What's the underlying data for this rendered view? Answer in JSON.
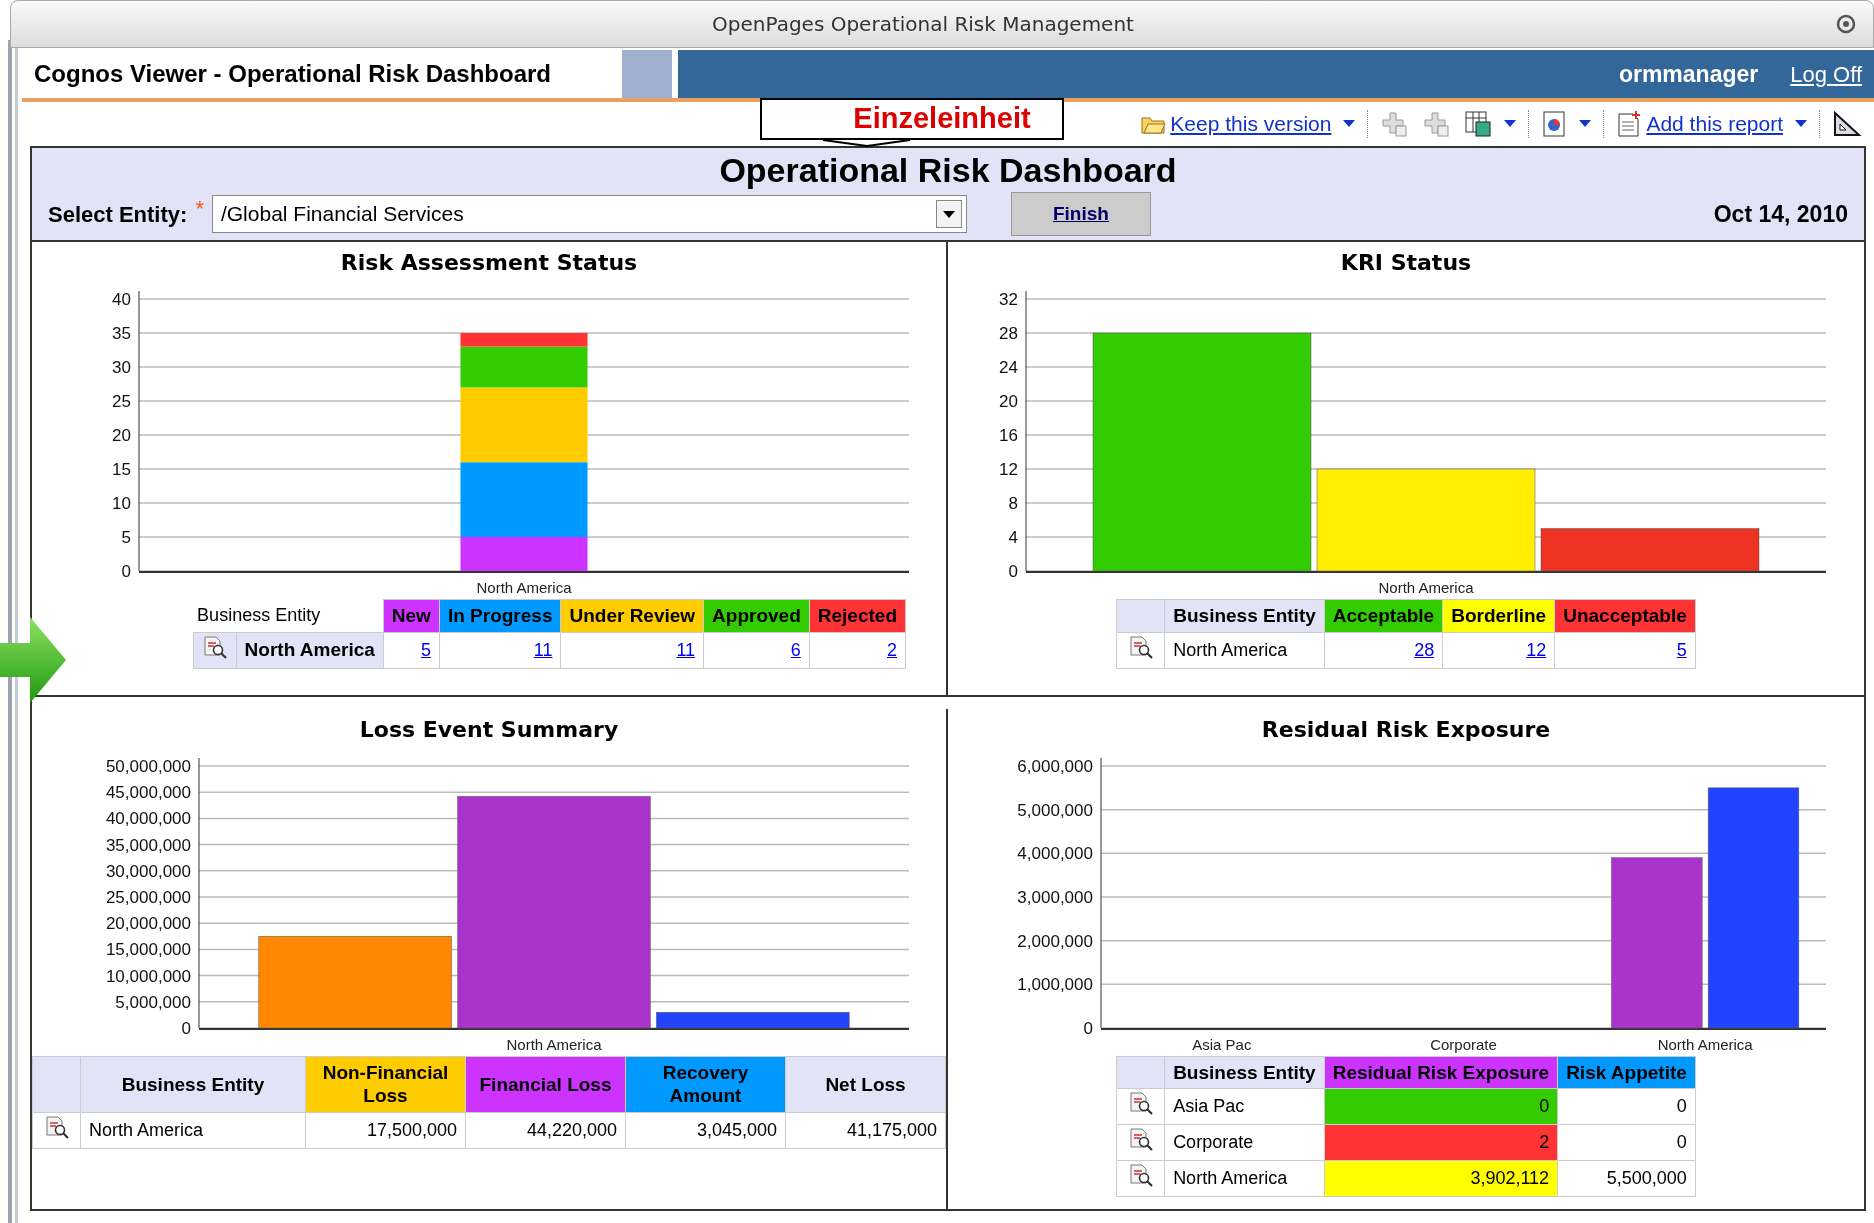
{
  "window": {
    "title": "OpenPages Operational Risk Management"
  },
  "header": {
    "title": "Cognos Viewer - Operational Risk Dashboard",
    "user": "ormmanager",
    "logoff": "Log Off"
  },
  "callout": {
    "text": "Einzeleinheit"
  },
  "toolbar": {
    "keep": "Keep this version",
    "add": "Add this report"
  },
  "dashboard": {
    "title": "Operational Risk Dashboard",
    "entity_label": "Select Entity:",
    "required_mark": "*",
    "entity_value": "/Global Financial Services",
    "finish": "Finish",
    "date": "Oct 14, 2010"
  },
  "panels": [
    {
      "title": "Risk Assessment Status",
      "chart_data": {
        "type": "bar",
        "stacked": true,
        "grid": true,
        "categories": [
          "North America"
        ],
        "series": [
          {
            "color": "#cc33ff",
            "values": [
              5
            ]
          },
          {
            "color": "#0099ff",
            "values": [
              11
            ]
          },
          {
            "color": "#ffcc00",
            "values": [
              11
            ]
          },
          {
            "color": "#33cc00",
            "values": [
              6
            ]
          },
          {
            "color": "#ff3333",
            "values": [
              2
            ]
          }
        ],
        "ylim": [
          0,
          40
        ],
        "yticks": [
          0,
          5,
          10,
          15,
          20,
          25,
          30,
          35,
          40
        ]
      },
      "table": {
        "entity_emphasis": true,
        "values_are_links": true,
        "entity_header": "Business Entity",
        "columns": [
          {
            "label": "New",
            "color": "#cc33ff"
          },
          {
            "label": "In Progress",
            "color": "#0099ff"
          },
          {
            "label": "Under Review",
            "color": "#ffcc00"
          },
          {
            "label": "Approved",
            "color": "#33cc00"
          },
          {
            "label": "Rejected",
            "color": "#ff3333"
          }
        ],
        "rows": [
          {
            "entity": "North America",
            "cells": [
              {
                "text": "5"
              },
              {
                "text": "11"
              },
              {
                "text": "11"
              },
              {
                "text": "6"
              },
              {
                "text": "2"
              }
            ]
          }
        ]
      }
    },
    {
      "title": "KRI Status",
      "chart_data": {
        "type": "bar",
        "grid": true,
        "categories": [
          "North America"
        ],
        "series": [
          {
            "color": "#33cc00",
            "values": [
              28
            ]
          },
          {
            "color": "#ffee00",
            "values": [
              12
            ]
          },
          {
            "color": "#ee3322",
            "values": [
              5
            ]
          }
        ],
        "ylim": [
          0,
          32
        ],
        "yticks": [
          0,
          4,
          8,
          12,
          16,
          20,
          24,
          28,
          32
        ]
      },
      "table": {
        "entity_emphasis": false,
        "values_are_links": true,
        "entity_header": "Business Entity",
        "columns": [
          {
            "label": "Acceptable",
            "color": "#33cc00"
          },
          {
            "label": "Borderline",
            "color": "#ffff00"
          },
          {
            "label": "Unacceptable",
            "color": "#ff3333"
          }
        ],
        "rows": [
          {
            "entity": "North America",
            "cells": [
              {
                "text": "28"
              },
              {
                "text": "12"
              },
              {
                "text": "5"
              }
            ]
          }
        ]
      }
    },
    {
      "title": "Loss Event Summary",
      "chart_data": {
        "type": "bar",
        "grid": true,
        "categories": [
          "North America"
        ],
        "series": [
          {
            "color": "#ff8800",
            "values": [
              17500000
            ]
          },
          {
            "color": "#aa33cc",
            "values": [
              44200000
            ]
          },
          {
            "color": "#2244ff",
            "values": [
              3000000
            ]
          }
        ],
        "ylim": [
          0,
          50000000
        ],
        "yticks": [
          {
            "value": 0,
            "label": "0"
          },
          {
            "value": 5000000,
            "label": "5,000,000"
          },
          {
            "value": 10000000,
            "label": "10,000,000"
          },
          {
            "value": 15000000,
            "label": "15,000,000"
          },
          {
            "value": 20000000,
            "label": "20,000,000"
          },
          {
            "value": 25000000,
            "label": "25,000,000"
          },
          {
            "value": 30000000,
            "label": "30,000,000"
          },
          {
            "value": 35000000,
            "label": "35,000,000"
          },
          {
            "value": 40000000,
            "label": "40,000,000"
          },
          {
            "value": 45000000,
            "label": "45,000,000"
          },
          {
            "value": 50000000,
            "label": "50,000,000"
          }
        ]
      },
      "table": {
        "entity_emphasis": false,
        "values_are_links": false,
        "entity_header": "Business Entity",
        "columns": [
          {
            "label": "Non-Financial Loss",
            "color": "#ffcc00"
          },
          {
            "label": "Financial Loss",
            "color": "#cc33ff"
          },
          {
            "label": "Recovery Amount",
            "color": "#0099ff"
          },
          {
            "label": "Net Loss"
          }
        ],
        "rows": [
          {
            "entity": "North America",
            "cells": [
              {
                "text": "17,500,000"
              },
              {
                "text": "44,220,000"
              },
              {
                "text": "3,045,000"
              },
              {
                "text": "41,175,000"
              }
            ]
          }
        ]
      }
    },
    {
      "title": "Residual Risk Exposure",
      "chart_data": {
        "type": "bar",
        "grid": true,
        "categories": [
          "Asia Pac",
          "Corporate",
          "North America"
        ],
        "series": [
          {
            "color": "#aa33cc",
            "values": [
              0,
              0,
              3900000
            ]
          },
          {
            "color": "#2244ff",
            "values": [
              0,
              0,
              5500000
            ]
          }
        ],
        "ylim": [
          0,
          6000000
        ],
        "yticks": [
          {
            "value": 0,
            "label": "0"
          },
          {
            "value": 1000000,
            "label": "1,000,000"
          },
          {
            "value": 2000000,
            "label": "2,000,000"
          },
          {
            "value": 3000000,
            "label": "3,000,000"
          },
          {
            "value": 4000000,
            "label": "4,000,000"
          },
          {
            "value": 5000000,
            "label": "5,000,000"
          },
          {
            "value": 6000000,
            "label": "6,000,000"
          }
        ]
      },
      "table": {
        "entity_emphasis": false,
        "values_are_links": false,
        "entity_header": "Business Entity",
        "columns": [
          {
            "label": "Residual Risk Exposure",
            "color": "#cc33ff"
          },
          {
            "label": "Risk Appetite",
            "color": "#0099ff"
          }
        ],
        "rows": [
          {
            "entity": "Asia Pac",
            "cells": [
              {
                "text": "0",
                "color": "#33cc00"
              },
              {
                "text": "0"
              }
            ]
          },
          {
            "entity": "Corporate",
            "cells": [
              {
                "text": "2",
                "color": "#ff3333"
              },
              {
                "text": "0"
              }
            ]
          },
          {
            "entity": "North America",
            "cells": [
              {
                "text": "3,902,112",
                "color": "#ffff00"
              },
              {
                "text": "5,500,000"
              }
            ]
          }
        ]
      }
    }
  ]
}
